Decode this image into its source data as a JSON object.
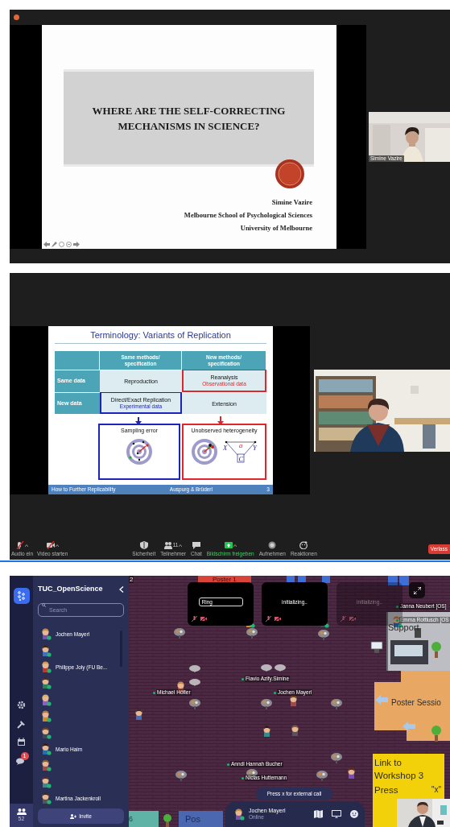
{
  "presentation_1": {
    "slide": {
      "title": "WHERE ARE THE SELF-CORRECTING MECHANISMS IN SCIENCE?",
      "author_lines": [
        "Simine Vazire",
        "Melbourne School of Psychological Sciences",
        "University of Melbourne"
      ]
    },
    "video": {
      "name": "Simine Vazire"
    }
  },
  "presentation_2": {
    "slide": {
      "title": "Terminology: Variants of Replication",
      "column_headers": [
        "Same methods/ specification",
        "New methods/ specification"
      ],
      "rows": [
        {
          "label": "Same data",
          "cells": [
            {
              "text": "Reproduction"
            },
            {
              "text": "Reanalysis",
              "note": "Observational data",
              "color": "#e0262b"
            }
          ]
        },
        {
          "label": "New data",
          "cells": [
            {
              "text": "Direct/Exact Replication",
              "note": "Experimental data",
              "color": "#1d24b8"
            },
            {
              "text": "Extension"
            }
          ]
        }
      ],
      "outcomes": [
        {
          "title": "Sampling error",
          "color": "#1d24b8",
          "kind": "target"
        },
        {
          "title": "Unobserved heterogeneity",
          "color": "#e0262b",
          "kind": "target_diagram"
        }
      ],
      "diagram_labels": [
        "X",
        "a",
        "Y",
        "C"
      ],
      "footer": [
        "How to Further Replicability",
        "Auspurg & Brüderl",
        "3"
      ]
    },
    "toolbar": [
      {
        "kind": "mic",
        "label": "Audio ein",
        "muted": true,
        "caret": true,
        "active": false
      },
      {
        "kind": "camera",
        "label": "Video starten",
        "muted": true,
        "caret": true,
        "active": false
      },
      {
        "kind": "shield",
        "label": "Sicherheit",
        "caret": false,
        "active": false
      },
      {
        "kind": "people",
        "label": "Teilnehmer",
        "count": "11",
        "caret": true,
        "active": false
      },
      {
        "kind": "chat",
        "label": "Chat",
        "caret": false,
        "active": false
      },
      {
        "kind": "share",
        "label": "Bildschirm freigeben",
        "caret": true,
        "active": true
      },
      {
        "kind": "record",
        "label": "Aufnehmen",
        "caret": false,
        "active": false
      },
      {
        "kind": "reaction",
        "label": "Reaktionen",
        "caret": false,
        "active": false
      }
    ],
    "leave_button": "Verlass"
  },
  "gather": {
    "rail": {
      "chat_badge": "1",
      "people_count": "52"
    },
    "space": {
      "title": "TUC_OpenScience",
      "search": {
        "placeholder": "Search"
      },
      "members": [
        {
          "name": "Jochen Mayerl",
          "online": true
        },
        {
          "online": true
        },
        {
          "name": "Philippe Joly (FU Be...",
          "online": true
        },
        {
          "online": true
        },
        {
          "online": true
        },
        {
          "online": true
        },
        {
          "online": true
        },
        {
          "name": "Mario Haim",
          "online": true
        },
        {
          "online": true
        },
        {
          "online": true
        },
        {
          "name": "Martina Jackenkroll",
          "online": true
        }
      ],
      "invite_button": "Invite"
    },
    "map": {
      "tiles": [
        {
          "kind": "field",
          "text": "Ring",
          "dimmed": false
        },
        {
          "kind": "status",
          "text": "initializing..",
          "dimmed": false
        },
        {
          "kind": "status",
          "text": "initializing..",
          "dimmed": true
        }
      ],
      "labels": [
        "2",
        "Poster 1",
        "Support",
        "Poster Sessio",
        "6",
        "Pos"
      ],
      "name_tags": [
        "Janna Neubert [OS]",
        "Emma Rottlusch [OS",
        "Flavio Azify.Simine",
        "Michael Höfler",
        "Jochen Mayerl",
        "Anndl Hannah Bucher",
        "Niclas Huttemann"
      ],
      "workshop_sign": {
        "lines": [
          "Link to",
          "Workshop 3"
        ],
        "press": "Press",
        "key": "\"x\""
      },
      "hint": "Press x for external call",
      "self": {
        "name": "Jochen Mayerl",
        "status": "Online"
      }
    }
  }
}
